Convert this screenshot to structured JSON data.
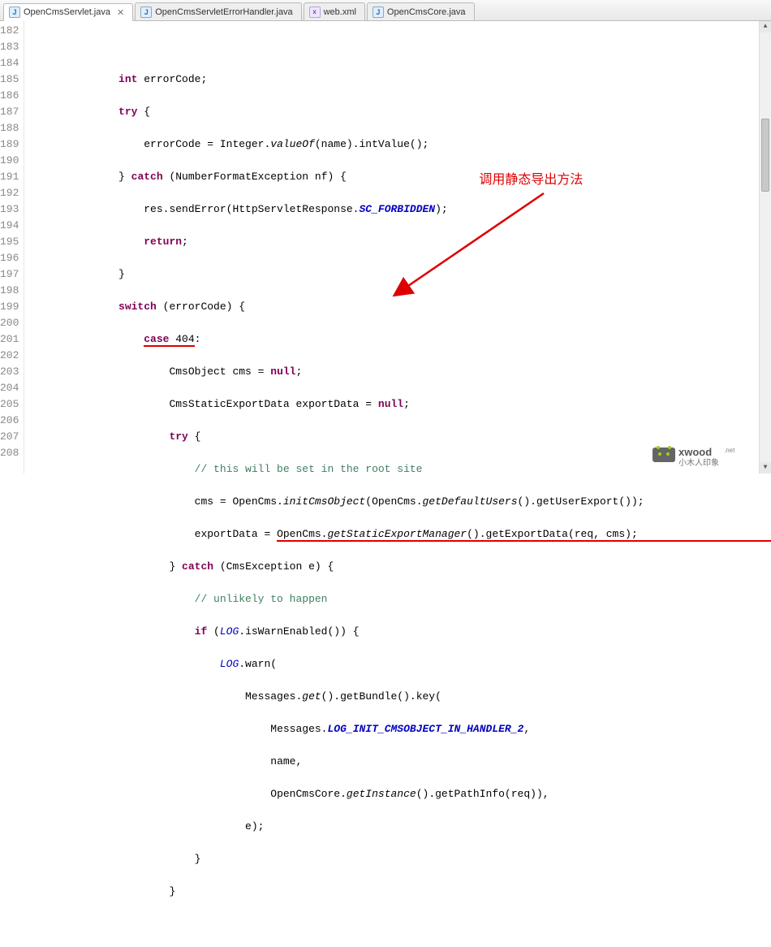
{
  "tabs": [
    {
      "label": "OpenCmsServlet.java",
      "active": true,
      "kind": "java"
    },
    {
      "label": "OpenCmsServletErrorHandler.java",
      "active": false,
      "kind": "java"
    },
    {
      "label": "web.xml",
      "active": false,
      "kind": "xml"
    },
    {
      "label": "OpenCmsCore.java",
      "active": false,
      "kind": "java"
    }
  ],
  "line_start": 182,
  "line_end": 208,
  "annotation_text": "调用静态导出方法",
  "code": {
    "l182": "",
    "l183_kw1": "int",
    "l183_rest": " errorCode;",
    "l184_kw1": "try",
    "l184_rest": " {",
    "l185_a": "errorCode = Integer.",
    "l185_m": "valueOf",
    "l185_b": "(name).intValue();",
    "l186_a": "} ",
    "l186_kw": "catch",
    "l186_b": " (NumberFormatException nf) {",
    "l187_a": "res.sendError(HttpServletResponse.",
    "l187_c": "SC_FORBIDDEN",
    "l187_b": ");",
    "l188_kw": "return",
    "l188_b": ";",
    "l189": "}",
    "l190_kw": "switch",
    "l190_b": " (errorCode) {",
    "l191_kw": "case",
    "l191_n": " 404",
    "l191_c": ":",
    "l192_a": "CmsObject cms = ",
    "l192_kw": "null",
    "l192_b": ";",
    "l193_a": "CmsStaticExportData exportData = ",
    "l193_kw": "null",
    "l193_b": ";",
    "l194_kw": "try",
    "l194_b": " {",
    "l195_c": "// this will be set in the root site",
    "l196_a": "cms = OpenCms.",
    "l196_m1": "initCmsObject",
    "l196_b": "(OpenCms.",
    "l196_m2": "getDefaultUsers",
    "l196_c": "().getUserExport());",
    "l197_a": "exportData = ",
    "l197_u": "OpenCms",
    "l197_d": ".",
    "l197_m": "getStaticExportManager",
    "l197_b": "().getExportData(req, cms);",
    "l198_a": "} ",
    "l198_kw": "catch",
    "l198_b": " (CmsException e) {",
    "l199_c": "// unlikely to happen",
    "l200_kw": "if",
    "l200_a": " (",
    "l200_l": "LOG",
    "l200_b": ".isWarnEnabled()) {",
    "l201_l": "LOG",
    "l201_b": ".warn(",
    "l202_a": "Messages.",
    "l202_m": "get",
    "l202_b": "().getBundle().key(",
    "l203_a": "Messages.",
    "l203_c": "LOG_INIT_CMSOBJECT_IN_HANDLER_2",
    "l203_b": ",",
    "l204": "name,",
    "l205_a": "OpenCmsCore.",
    "l205_m": "getInstance",
    "l205_b": "().getPathInfo(req)),",
    "l206": "e);",
    "l207": "}",
    "l208": "}"
  },
  "watermark": {
    "brand": "xwood",
    "sub": "小木人印象",
    "tld": ".net"
  }
}
